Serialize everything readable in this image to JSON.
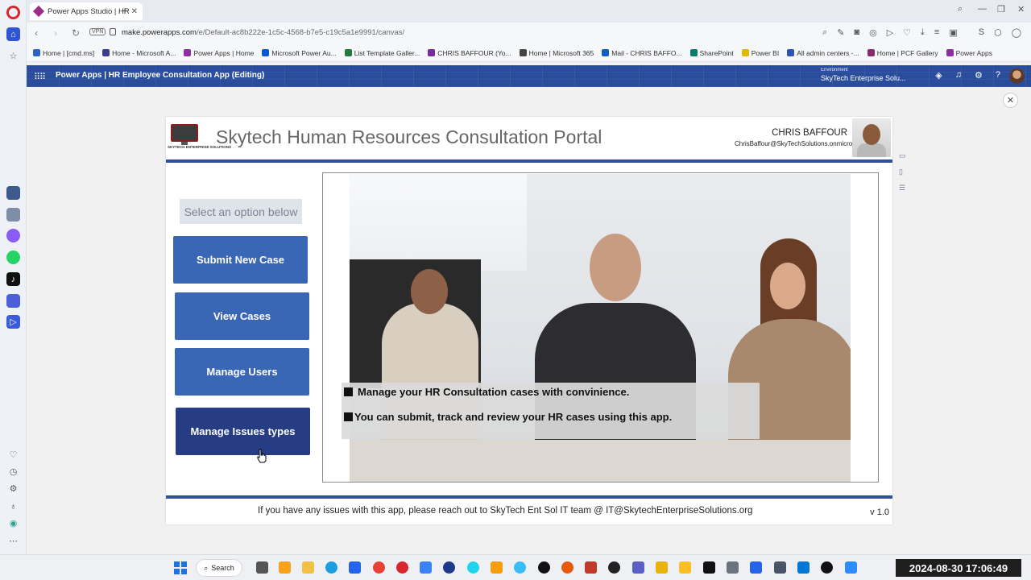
{
  "browser": {
    "tab_title": "Power Apps Studio | HR",
    "url_host": "make.powerapps.com",
    "url_path": "/e/Default-ac8b222e-1c5c-4568-b7e5-c19c5a1e9991/canvas/",
    "vpn": "VPN",
    "bookmarks": [
      "Home | [cmd.ms]",
      "Home - Microsoft A...",
      "Power Apps | Home",
      "Microsoft Power Au...",
      "List Template Galler...",
      "CHRIS BAFFOUR (Yo...",
      "Home | Microsoft 365",
      "Mail - CHRIS BAFFO...",
      "SharePoint",
      "Power BI",
      "All admin centers -...",
      "Home | PCF Gallery",
      "Power Apps"
    ]
  },
  "studio": {
    "title": "Power Apps  |  HR Employee Consultation App (Editing)",
    "env_label": "Environment",
    "env_name": "SkyTech Enterprise Solu..."
  },
  "app": {
    "logo_text": "SKYTECH ENTERPRISE SOLUTIONS",
    "title": "Skytech Human Resources Consultation Portal",
    "user_name": "CHRIS BAFFOUR",
    "user_email": "ChrisBaffour@SkyTechSolutions.onmicrosoft.com",
    "select_label": "Select an option below",
    "buttons": {
      "submit": "Submit New Case",
      "view": "View Cases",
      "manage_users": "Manage Users",
      "manage_issues": "Manage Issues types"
    },
    "overlay_lines": [
      "Manage your HR Consultation cases with convinience.",
      "You can submit, track and review your HR cases using this app."
    ],
    "footer": "If you have any issues with this app, please reach out to SkyTech Ent Sol IT team @ IT@SkytechEnterpriseSolutions.org",
    "version": "v 1.0"
  },
  "taskbar": {
    "search": "Search",
    "clock": "2024-08-30  17:06:49"
  },
  "colors": {
    "header_blue": "#2a4d9b",
    "button_blue": "#3a66b6",
    "button_dark": "#263c83",
    "rule_blue": "#2f4f9a"
  }
}
